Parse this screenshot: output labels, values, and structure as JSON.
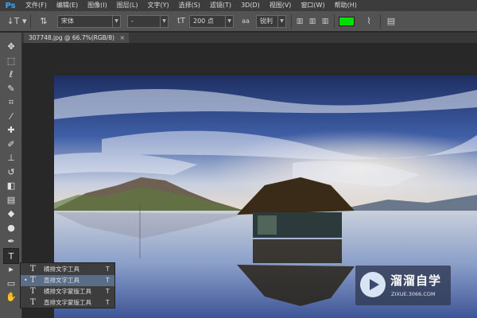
{
  "app": {
    "logo_text": "Ps"
  },
  "menu": {
    "items": [
      {
        "label": "文件(F)"
      },
      {
        "label": "编辑(E)"
      },
      {
        "label": "图像(I)"
      },
      {
        "label": "图层(L)"
      },
      {
        "label": "文字(Y)"
      },
      {
        "label": "选择(S)"
      },
      {
        "label": "滤镜(T)"
      },
      {
        "label": "3D(D)"
      },
      {
        "label": "视图(V)"
      },
      {
        "label": "窗口(W)"
      },
      {
        "label": "帮助(H)"
      }
    ]
  },
  "options": {
    "font_family": "宋体",
    "font_style": "-",
    "font_size": "200 点",
    "antialias_icon": "aa",
    "antialias": "锐利",
    "text_color": "#00e000",
    "icons": {
      "tool_preset": "vertical-type-icon",
      "orientation": "toggle-orientation-icon",
      "size": "font-size-icon",
      "align_left": "align-left-icon",
      "align_center": "align-center-icon",
      "align_right": "align-right-icon",
      "warp": "warp-text-icon",
      "panels": "character-panel-icon"
    }
  },
  "document": {
    "tab_label": "307748.jpg @ 66.7%(RGB/8)",
    "close_label": "×"
  },
  "tools": [
    {
      "name": "move-tool-icon",
      "glyph": "✥"
    },
    {
      "name": "marquee-tool-icon",
      "glyph": "⬚"
    },
    {
      "name": "lasso-tool-icon",
      "glyph": "ℓ"
    },
    {
      "name": "quick-selection-tool-icon",
      "glyph": "✎"
    },
    {
      "name": "crop-tool-icon",
      "glyph": "⌗"
    },
    {
      "name": "eyedropper-tool-icon",
      "glyph": "⁄"
    },
    {
      "name": "healing-brush-tool-icon",
      "glyph": "✚"
    },
    {
      "name": "brush-tool-icon",
      "glyph": "✐"
    },
    {
      "name": "clone-stamp-tool-icon",
      "glyph": "⊥"
    },
    {
      "name": "history-brush-tool-icon",
      "glyph": "↺"
    },
    {
      "name": "eraser-tool-icon",
      "glyph": "◧"
    },
    {
      "name": "gradient-tool-icon",
      "glyph": "▤"
    },
    {
      "name": "blur-tool-icon",
      "glyph": "◆"
    },
    {
      "name": "dodge-tool-icon",
      "glyph": "●"
    },
    {
      "name": "pen-tool-icon",
      "glyph": "✒"
    },
    {
      "name": "type-tool-icon",
      "glyph": "T"
    },
    {
      "name": "path-selection-tool-icon",
      "glyph": "▸"
    },
    {
      "name": "rectangle-tool-icon",
      "glyph": "▭"
    },
    {
      "name": "hand-tool-icon",
      "glyph": "✋"
    }
  ],
  "type_flyout": {
    "items": [
      {
        "label": "横排文字工具",
        "key": "T",
        "icon": "T",
        "selected": false,
        "checked": ""
      },
      {
        "label": "直排文字工具",
        "key": "T",
        "icon": "T",
        "selected": true,
        "checked": "•"
      },
      {
        "label": "横排文字蒙版工具",
        "key": "T",
        "icon": "T",
        "selected": false,
        "checked": ""
      },
      {
        "label": "直排文字蒙版工具",
        "key": "T",
        "icon": "T",
        "selected": false,
        "checked": ""
      }
    ]
  },
  "watermark": {
    "title": "溜溜自学",
    "url": "ZIXUE.3066.COM"
  }
}
